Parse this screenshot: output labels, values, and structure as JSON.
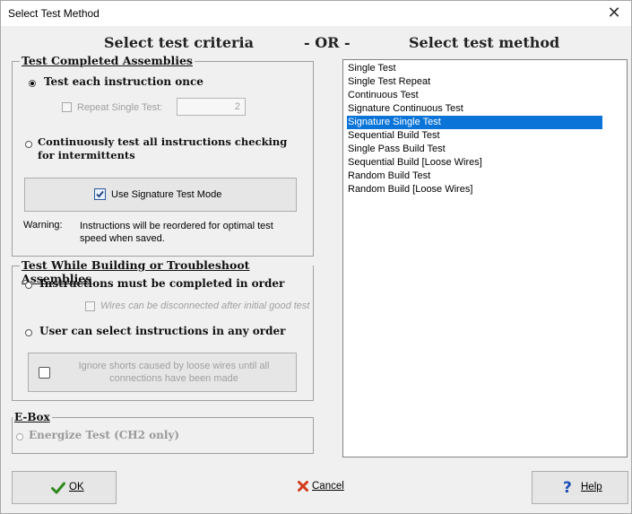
{
  "window": {
    "title": "Select Test Method",
    "close_glyph": "✕"
  },
  "headers": {
    "left": "Select test criteria",
    "or": "- OR -",
    "right": "Select test method"
  },
  "completed": {
    "legend": "Test Completed Assemblies",
    "radio_once": "Test each instruction once",
    "repeat_label": "Repeat Single Test:",
    "repeat_value": "2",
    "radio_continuous": "Continuously test all instructions checking for intermittents",
    "signature_button": "Use Signature Test Mode",
    "warning_label": "Warning:",
    "warning_text": "Instructions will be reordered for optimal test speed when saved."
  },
  "building": {
    "legend": "Test While Building or Troubleshoot Assemblies",
    "radio_order": "Instructions must be completed in order",
    "disconnect_label": "Wires can be disconnected after initial good test",
    "radio_any": "User can select instructions in any order",
    "ignore_shorts_button": "Ignore shorts caused by loose wires until all connections have been made"
  },
  "ebox": {
    "legend": "E-Box",
    "radio_energize": "Energize Test (CH2 only)"
  },
  "methods": {
    "items": [
      "Single Test",
      "Single Test Repeat",
      "Continuous Test",
      "Signature Continuous Test",
      "Signature Single Test",
      "Sequential Build Test",
      "Single Pass Build Test",
      "Sequential Build [Loose Wires]",
      "Random Build Test",
      "Random Build [Loose Wires]"
    ],
    "selected": "Signature Single Test"
  },
  "buttons": {
    "ok": "OK",
    "cancel": "Cancel",
    "help": "Help"
  },
  "colors": {
    "selection": "#0a74d8",
    "ok_check": "#2f8a1e",
    "cancel_x": "#d23a1a",
    "help_q": "#1a4fb8"
  }
}
